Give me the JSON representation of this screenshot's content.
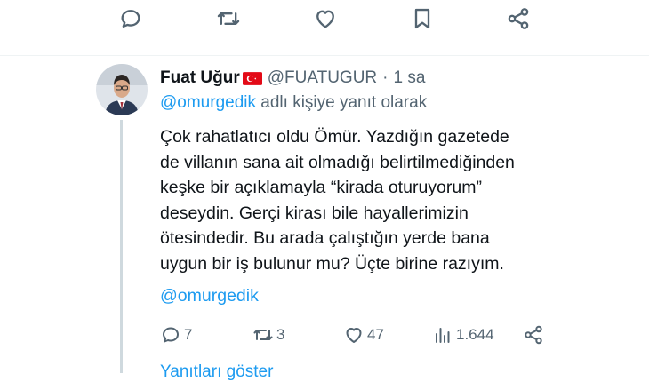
{
  "top_actions": [
    {
      "name": "reply-icon"
    },
    {
      "name": "retweet-icon"
    },
    {
      "name": "like-icon"
    },
    {
      "name": "bookmark-icon"
    },
    {
      "name": "share-icon"
    }
  ],
  "tweet": {
    "author_name": "Fuat Uğur",
    "flag_icon": "turkey-flag-icon",
    "handle": "@FUATUGUR",
    "separator": "·",
    "time": "1 sa",
    "reply_to_mention": "@omurgedik",
    "reply_to_suffix": " adlı kişiye yanıt olarak",
    "text_lines": [
      "Çok rahatlatıcı oldu Ömür. Yazdığın gazetede",
      "de villanın sana ait olmadığı belirtilmediğinden",
      "keşke bir açıklamayla “kirada oturuyorum”",
      "deseydin. Gerçi kirası bile hayallerimizin",
      "ötesindedir. Bu arada çalıştığın yerde bana",
      "uygun bir iş bulunur mu? Üçte birine razıyım."
    ],
    "mention_end": "@omurgedik",
    "actions": {
      "replies": "7",
      "retweets": "3",
      "likes": "47",
      "views": "1.644"
    }
  },
  "show_more": "Yanıtları göster",
  "colors": {
    "icon_gray": "#536471",
    "link_blue": "#1d9bf0",
    "text": "#0f1419",
    "flag_red": "#e30a17"
  }
}
